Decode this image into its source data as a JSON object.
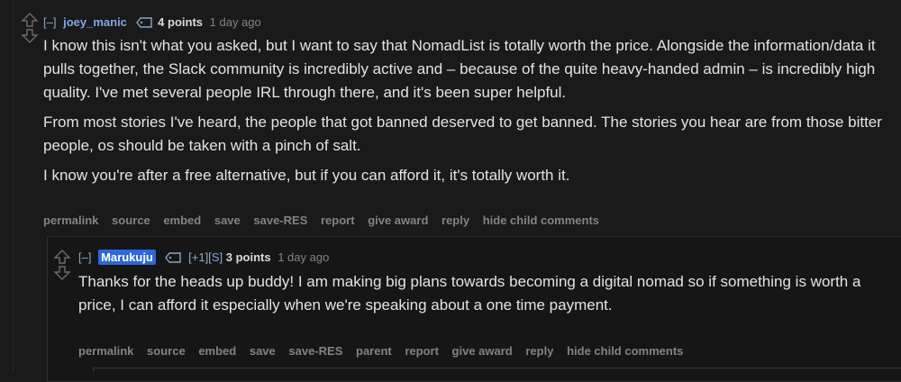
{
  "parent": {
    "collapse": "[–]",
    "author": "joey_manic",
    "score": "4 points",
    "time": "1 day ago",
    "paragraphs": [
      "I know this isn't what you asked, but I want to say that NomadList is totally worth the price. Alongside the information/data it pulls together, the Slack community is incredibly active and – because of the quite heavy-handed admin – is incredibly high quality. I've met several people IRL through there, and it's been super helpful.",
      "From most stories I've heard, the people that got banned deserved to get banned. The stories you hear are from those bitter people, os should be taken with a pinch of salt.",
      "I know you're after a free alternative, but if you can afford it, it's totally worth it."
    ],
    "actions": [
      "permalink",
      "source",
      "embed",
      "save",
      "save-RES",
      "report",
      "give award",
      "reply",
      "hide child comments"
    ]
  },
  "child": {
    "collapse": "[–]",
    "author": "Marukuju",
    "flair_open": "[+1][",
    "flair_s": "S",
    "flair_close": "]",
    "score": "3 points",
    "time": "1 day ago",
    "paragraphs": [
      "Thanks for the heads up buddy! I am making big plans towards becoming a digital nomad so if something is worth a price, I can afford it especially when we're speaking about a one time payment."
    ],
    "actions": [
      "permalink",
      "source",
      "embed",
      "save",
      "save-RES",
      "parent",
      "report",
      "give award",
      "reply",
      "hide child comments"
    ]
  },
  "icons": {
    "upvote": "upvote-arrow-icon",
    "downvote": "downvote-arrow-icon",
    "tag": "user-tag-icon"
  }
}
